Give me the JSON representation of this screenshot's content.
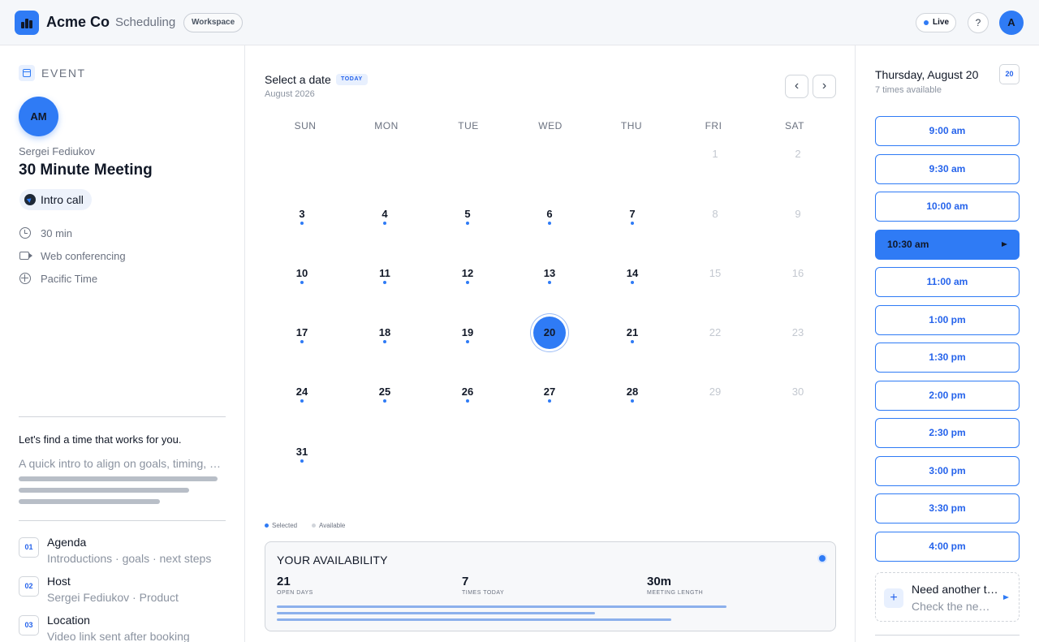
{
  "header": {
    "brand": "Acme Co",
    "product": "Scheduling",
    "workspace_label": "Workspace",
    "live_label": "Live",
    "help_label": "?",
    "user_initial": "A"
  },
  "event": {
    "section_label": "EVENT",
    "host_initials": "AM",
    "host_name": "Sergei Fediukov",
    "title": "30 Minute Meeting",
    "chip_label": "Intro call",
    "meta": {
      "duration": "30 min",
      "conferencing": "Web conferencing",
      "timezone": "Pacific Time"
    },
    "find_time": "Let's find a time that works for you.",
    "description": "A quick intro to align on goals, timing, and next steps.",
    "items": [
      {
        "num": "01",
        "title": "Agenda",
        "sub": "Introductions · goals · next steps"
      },
      {
        "num": "02",
        "title": "Host",
        "sub": "Sergei Fediukov · Product"
      },
      {
        "num": "03",
        "title": "Location",
        "sub": "Video link sent after booking"
      }
    ]
  },
  "calendar": {
    "title": "Select a date",
    "today_badge": "TODAY",
    "month": "August 2026",
    "prev_label": "‹",
    "next_label": "›",
    "weekdays": [
      "SUN",
      "MON",
      "TUE",
      "WED",
      "THU",
      "FRI",
      "SAT"
    ],
    "days": {
      "d1": "1",
      "d2": "2",
      "d3": "3",
      "d4": "4",
      "d5": "5",
      "d6": "6",
      "d7": "7",
      "d8": "8",
      "d9": "9",
      "d10": "10",
      "d11": "11",
      "d12": "12",
      "d13": "13",
      "d14": "14",
      "d15": "15",
      "d16": "16",
      "d17": "17",
      "d18": "18",
      "d19": "19",
      "d20": "20",
      "d21": "21",
      "d22": "22",
      "d23": "23",
      "d24": "24",
      "d25": "25",
      "d26": "26",
      "d27": "27",
      "d28": "28",
      "d29": "29",
      "d30": "30",
      "d31": "31"
    },
    "selected_day": "20",
    "legend": {
      "selected": "Selected",
      "available": "Available"
    },
    "legend_colors": {
      "selected": "#2f7bf5",
      "available": "#d1d5db"
    }
  },
  "availability": {
    "title": "YOUR AVAILABILITY",
    "stats": [
      {
        "value": "21",
        "label": "OPEN DAYS"
      },
      {
        "value": "7",
        "label": "TIMES TODAY"
      },
      {
        "value": "30m",
        "label": "MEETING LENGTH"
      }
    ]
  },
  "times": {
    "date": "Thursday, August 20",
    "subtitle": "7 times available",
    "day_badge": "20",
    "slots": [
      "9:00 am",
      "9:30 am",
      "10:00 am",
      "10:30 am",
      "11:00 am",
      "1:00 pm",
      "1:30 pm",
      "2:00 pm",
      "2:30 pm",
      "3:00 pm",
      "3:30 pm",
      "4:00 pm"
    ],
    "selected_slot": "10:30 am",
    "need_another": {
      "plus": "+",
      "title": "Need another time?",
      "sub": "Check the next available day"
    }
  },
  "colors": {
    "accent": "#2f7bf5",
    "accent_text": "#2563eb",
    "muted_text": "#8b93a0"
  },
  "icons": [
    "bar-chart-logo-icon",
    "calendar-icon",
    "send-icon",
    "clock-icon",
    "video-icon",
    "globe-icon",
    "chevron-left-icon",
    "chevron-right-icon",
    "plus-icon",
    "play-arrow-icon"
  ]
}
